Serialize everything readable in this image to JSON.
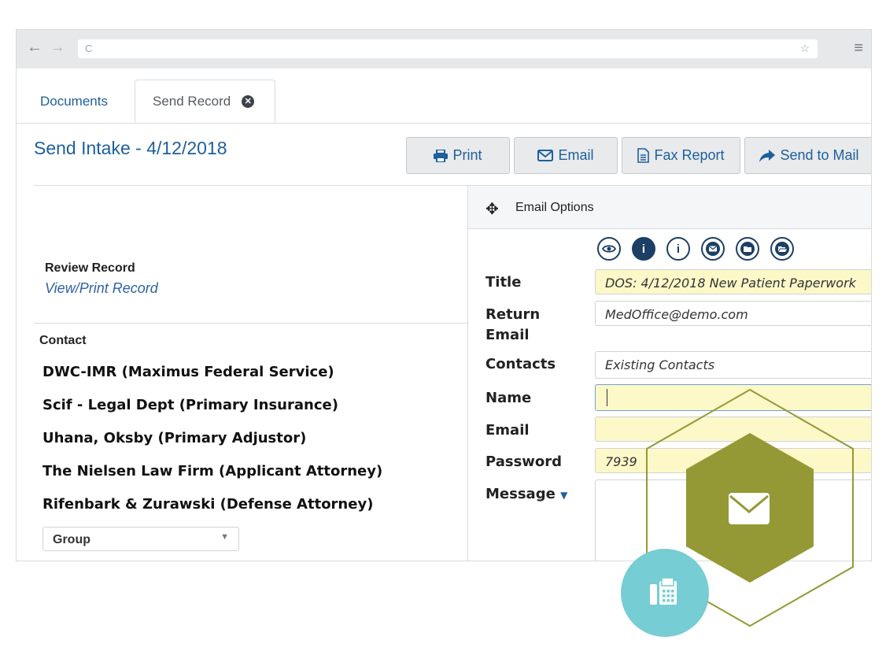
{
  "browser": {
    "back_icon": "arrow-left-icon",
    "forward_icon": "arrow-right-icon",
    "reload_icon": "reload-icon",
    "url": "",
    "bookmark_icon": "star-icon",
    "menu_icon": "hamburger-icon"
  },
  "tabs": [
    {
      "label": "Documents",
      "active": false
    },
    {
      "label": "Send Record",
      "active": true,
      "close_icon": "close-circle-icon"
    }
  ],
  "page": {
    "title": "Send Intake - 4/12/2018"
  },
  "toolbar": {
    "print": {
      "label": "Print",
      "icon": "print-icon"
    },
    "email": {
      "label": "Email",
      "icon": "envelope-icon"
    },
    "fax": {
      "label": "Fax Report",
      "icon": "document-icon"
    },
    "mail": {
      "label": "Send to Mail",
      "icon": "share-arrow-icon"
    }
  },
  "review": {
    "label": "Review Record",
    "link": "View/Print Record"
  },
  "contact": {
    "label": "Contact",
    "items": [
      "DWC-IMR (Maximus Federal Service)",
      "Scif - Legal Dept (Primary Insurance)",
      "Uhana, Oksby (Primary Adjustor)",
      "The Nielsen Law Firm (Applicant Attorney)",
      "Rifenbark & Zurawski (Defense Attorney)"
    ],
    "group_select": {
      "value": "Group"
    }
  },
  "email_options": {
    "title": "Email Options",
    "icons": [
      "eye-icon",
      "info-filled-icon",
      "info-icon",
      "envelope-circle-icon",
      "folder-icon",
      "folder-open-icon"
    ],
    "fields": {
      "title": {
        "label": "Title",
        "value": "DOS: 4/12/2018 New Patient Paperwork"
      },
      "return_email": {
        "label": "Return Email",
        "value": "MedOffice@demo.com"
      },
      "contacts": {
        "label": "Contacts",
        "value": "Existing Contacts"
      },
      "name": {
        "label": "Name",
        "value": ""
      },
      "email": {
        "label": "Email",
        "value": ""
      },
      "password": {
        "label": "Password",
        "value": "7939"
      },
      "message": {
        "label": "Message",
        "value": ""
      }
    }
  },
  "badges": {
    "hex_icon": "envelope-icon",
    "circle_icon": "fax-icon"
  },
  "colors": {
    "brand_blue": "#1e5f9c",
    "olive": "#949935",
    "teal": "#76cdd3",
    "field_yellow": "#fcf8c8"
  }
}
